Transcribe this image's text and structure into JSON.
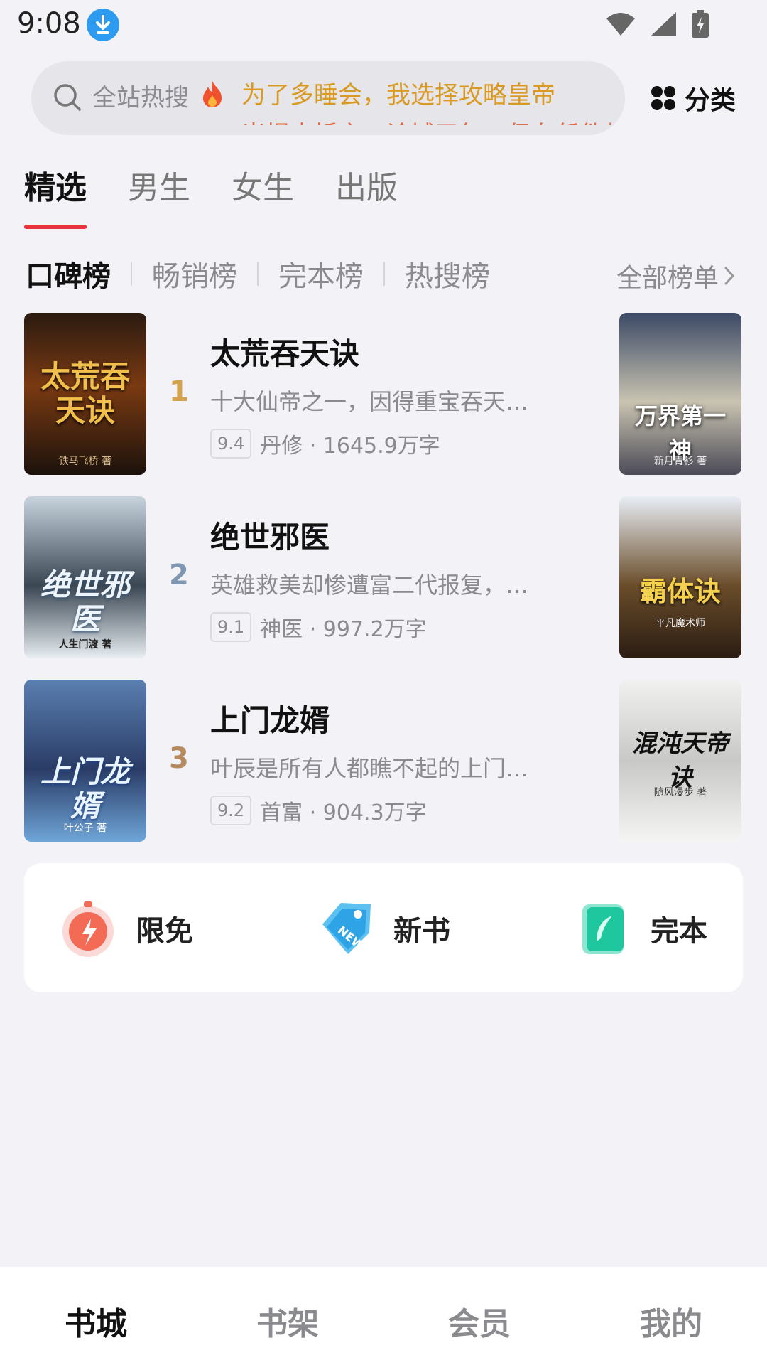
{
  "status_bar": {
    "time": "9:08"
  },
  "search": {
    "prefix": "全站热搜",
    "hot_lines": [
      "为了多睡会，我选择攻略皇帝",
      "米揭大拆之，论城三年，但在任件都跨工日"
    ]
  },
  "header": {
    "category_label": "分类"
  },
  "tabs": [
    {
      "label": "精选",
      "active": true
    },
    {
      "label": "男生",
      "active": false
    },
    {
      "label": "女生",
      "active": false
    },
    {
      "label": "出版",
      "active": false
    }
  ],
  "rank_tabs": [
    {
      "label": "口碑榜",
      "active": true
    },
    {
      "label": "畅销榜",
      "active": false
    },
    {
      "label": "完本榜",
      "active": false
    },
    {
      "label": "热搜榜",
      "active": false
    }
  ],
  "all_lists_label": "全部榜单",
  "books": [
    {
      "rank": "1",
      "rank_color": "#d4a24c",
      "title": "太荒吞天诀",
      "desc": "十大仙帝之一，因得重宝吞天神…",
      "score": "9.4",
      "meta": "丹修 · 1645.9万字",
      "cover_text": "太荒吞天诀",
      "cover_author": "铁马飞桥 著",
      "side_cover_text": "万界第一神",
      "side_cover_author": "新月青衫 著"
    },
    {
      "rank": "2",
      "rank_color": "#7f97b0",
      "title": "绝世邪医",
      "desc": "英雄救美却惨遭富二代报复，被…",
      "score": "9.1",
      "meta": "神医 · 997.2万字",
      "cover_text": "绝世邪医",
      "cover_author": "人生门渡 著",
      "side_cover_text": "霸体诀",
      "side_cover_author": "平凡魔术师"
    },
    {
      "rank": "3",
      "rank_color": "#b58a5f",
      "title": "上门龙婿",
      "desc": "叶辰是所有人都瞧不起的上门女…",
      "score": "9.2",
      "meta": "首富 · 904.3万字",
      "cover_text": "上门龙婿",
      "cover_author": "叶公子 著",
      "side_cover_text": "混沌天帝诀",
      "side_cover_author": "随风漫步 著"
    }
  ],
  "quick_entries": [
    {
      "label": "限免",
      "icon": "stopwatch-icon"
    },
    {
      "label": "新书",
      "icon": "new-tag-icon"
    },
    {
      "label": "完本",
      "icon": "book-feather-icon"
    }
  ],
  "bottom_nav": [
    {
      "label": "书城",
      "active": true
    },
    {
      "label": "书架",
      "active": false
    },
    {
      "label": "会员",
      "active": false
    },
    {
      "label": "我的",
      "active": false
    }
  ]
}
